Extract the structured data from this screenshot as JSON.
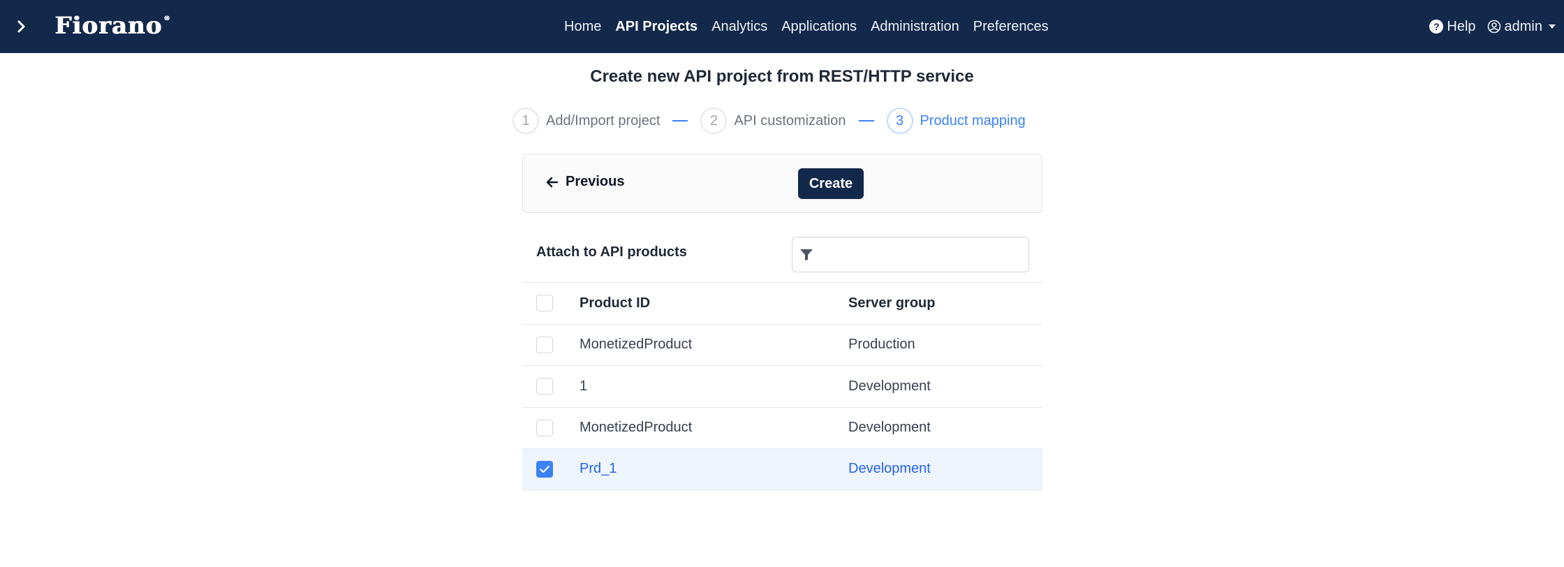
{
  "navbar": {
    "logo": "Fiorano",
    "logo_mark": "®",
    "menu": [
      {
        "label": "Home",
        "active": false
      },
      {
        "label": "API Projects",
        "active": true
      },
      {
        "label": "Analytics",
        "active": false
      },
      {
        "label": "Applications",
        "active": false
      },
      {
        "label": "Administration",
        "active": false
      },
      {
        "label": "Preferences",
        "active": false
      }
    ],
    "help_label": "Help",
    "user_label": "admin"
  },
  "page": {
    "title": "Create new API project from REST/HTTP service"
  },
  "stepper": {
    "steps": [
      {
        "num": "1",
        "label": "Add/Import project",
        "active": false
      },
      {
        "num": "2",
        "label": "API customization",
        "active": false
      },
      {
        "num": "3",
        "label": "Product mapping",
        "active": true
      }
    ]
  },
  "actions": {
    "previous_label": "Previous",
    "create_label": "Create"
  },
  "attach": {
    "label": "Attach to API products",
    "filter_value": ""
  },
  "table": {
    "headers": {
      "product_id": "Product ID",
      "server_group": "Server group"
    },
    "rows": [
      {
        "product_id": "MonetizedProduct",
        "server_group": "Production",
        "checked": false
      },
      {
        "product_id": "1",
        "server_group": "Development",
        "checked": false
      },
      {
        "product_id": "MonetizedProduct",
        "server_group": "Development",
        "checked": false
      },
      {
        "product_id": "Prd_1",
        "server_group": "Development",
        "checked": true
      }
    ]
  },
  "colors": {
    "navbar_bg": "#13294b",
    "accent": "#3b82f6",
    "selected_row_bg": "#eef5fd"
  },
  "icons": [
    "chevron-right-icon",
    "help-circle-icon",
    "user-circle-icon",
    "caret-down-icon",
    "arrow-left-icon",
    "filter-icon",
    "checkmark-icon"
  ]
}
